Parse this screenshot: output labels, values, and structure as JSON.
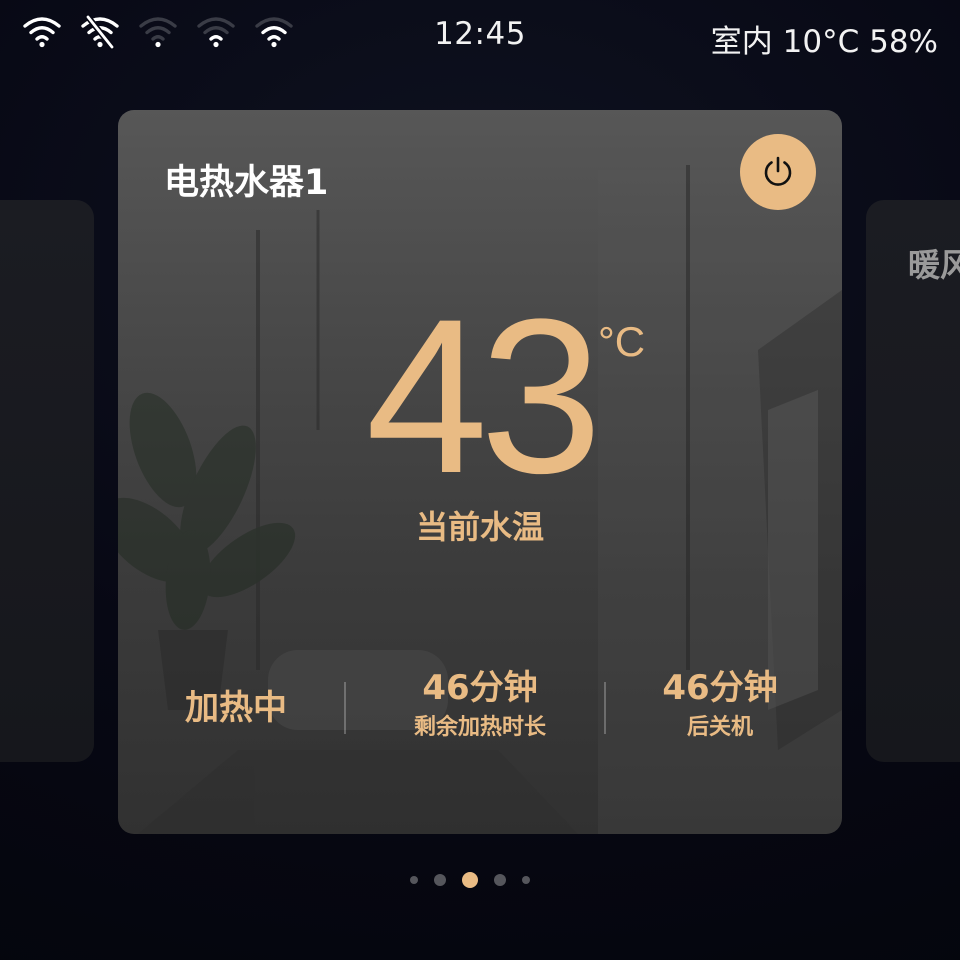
{
  "status_bar": {
    "wifi_icons": [
      "wifi-full-icon",
      "wifi-disabled-icon",
      "wifi-weak-icon",
      "wifi-medium-icon",
      "wifi-strong-icon"
    ],
    "time": "12:45",
    "indoor": "室内 10°C 58%"
  },
  "main_card": {
    "title": "电热水器1",
    "power_icon": "power-icon",
    "temperature": "43",
    "temperature_unit": "°C",
    "temperature_label": "当前水温",
    "status": "加热中",
    "remaining_value": "46分钟",
    "remaining_label": "剩余加热时长",
    "shutdown_value": "46分钟",
    "shutdown_label": "后关机"
  },
  "right_card": {
    "title": "暖风"
  },
  "pager": {
    "count": 5,
    "active_index": 2
  },
  "colors": {
    "accent": "#e9bb84",
    "background": "#070814",
    "card": "#474747"
  }
}
